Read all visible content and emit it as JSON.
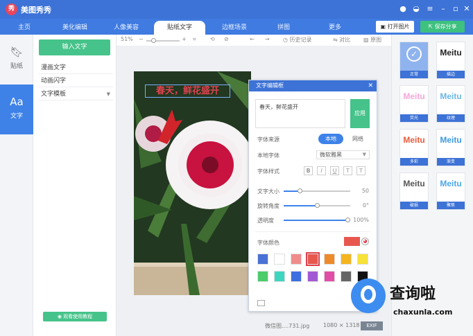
{
  "app": {
    "name": "美图秀秀",
    "logo_text": "秀"
  },
  "tabs": [
    "主页",
    "美化编辑",
    "人像美容",
    "贴纸文字",
    "边框场景",
    "拼图",
    "更多"
  ],
  "active_tab": "贴纸文字",
  "header_buttons": {
    "open": "打开图片",
    "save": "保存分享"
  },
  "left_nav": [
    {
      "label": "贴纸",
      "icon": "bookmark-icon"
    },
    {
      "label": "文字",
      "icon": "text-aa-icon"
    }
  ],
  "panel": {
    "input_button": "输入文字",
    "items": [
      "漫画文字",
      "动画闪字",
      "文字模板"
    ],
    "tutorial_button": "观看使用教程"
  },
  "toolbar": {
    "zoom": "51%",
    "history": "历史记录",
    "compare": "对比",
    "original": "原图"
  },
  "canvas": {
    "overlay_text": "春天，鲜花盛开"
  },
  "status": {
    "filename": "微信图....731.jpg",
    "dimensions": "1080 × 1318",
    "exif": "EXIF"
  },
  "dialog": {
    "title": "文字编辑框",
    "text_value": "春天，鲜花盛开",
    "apply": "应用",
    "font_source_label": "字体来源",
    "source_local": "本地",
    "source_online": "网络",
    "local_font_label": "本地字体",
    "local_font_value": "微软雅黑",
    "font_style_label": "字体样式",
    "font_size_label": "文字大小",
    "font_size_value": "50",
    "rotation_label": "旋转角度",
    "rotation_value": "0°",
    "opacity_label": "透明度",
    "opacity_value": "100%",
    "color_label": "字体颜色",
    "swatches": [
      "#4a72d4",
      "#ffffff",
      "#f08c8c",
      "#e8574e",
      "#ef8a2a",
      "#f4b51f",
      "#f7e23a",
      "#4ccc6a",
      "#3fd6c0",
      "#3d6fe0",
      "#a25ad4",
      "#e04ea6",
      "#666666",
      "#111111"
    ]
  },
  "styles": [
    {
      "name": "正常",
      "sample": "Meitu",
      "color": "#ffffff"
    },
    {
      "name": "描边",
      "sample": "Meitu",
      "color": "#222222"
    },
    {
      "name": "荧光",
      "sample": "Meitu",
      "color": "#f7a6d8"
    },
    {
      "name": "纹理",
      "sample": "Meitu",
      "color": "#6bb7e8"
    },
    {
      "name": "多彩",
      "sample": "Meitu",
      "color": "#e85a3a"
    },
    {
      "name": "渐变",
      "sample": "Meitu",
      "color": "#3d9ae0"
    },
    {
      "name": "破损",
      "sample": "Meitu",
      "color": "#555555"
    },
    {
      "name": "聚焦",
      "sample": "Meitu",
      "color": "#4ca6e8"
    }
  ],
  "watermark": {
    "name": "查询啦",
    "url": "chaxunla.com"
  }
}
